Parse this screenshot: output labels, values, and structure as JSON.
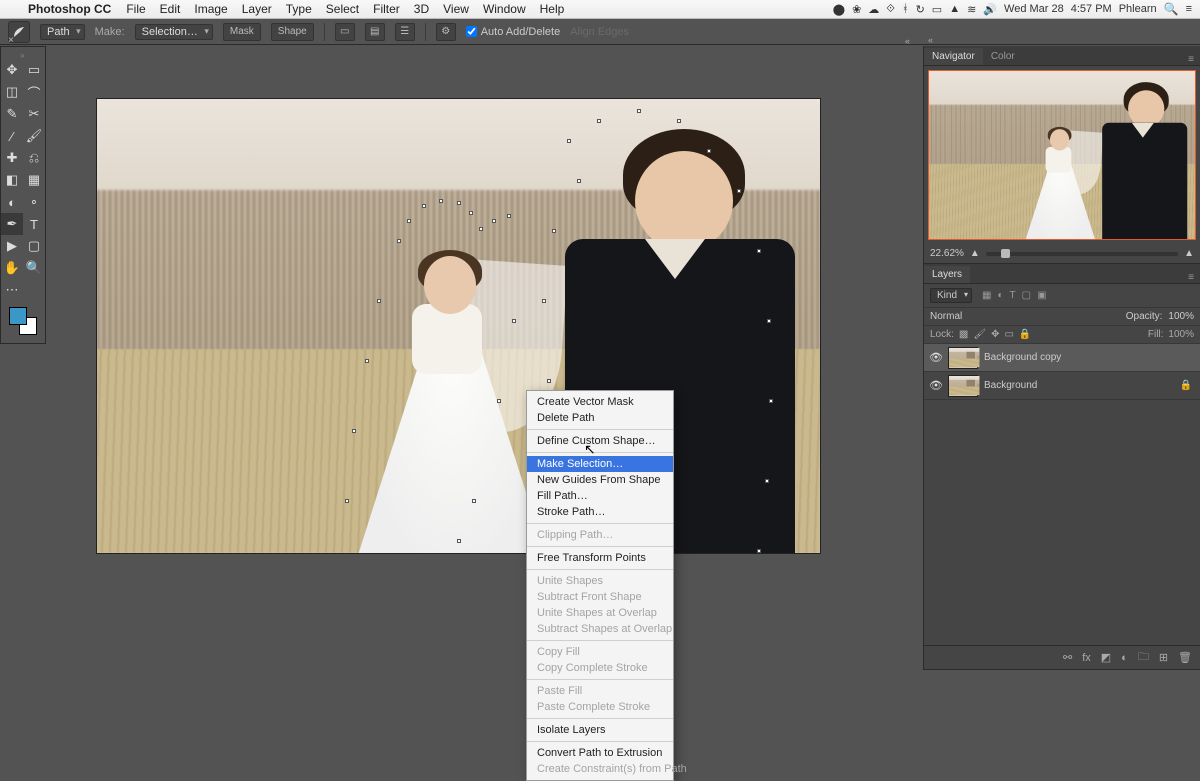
{
  "menubar": {
    "app": "Photoshop CC",
    "items": [
      "File",
      "Edit",
      "Image",
      "Layer",
      "Type",
      "Select",
      "Filter",
      "3D",
      "View",
      "Window",
      "Help"
    ],
    "tray": {
      "date": "Wed Mar 28",
      "time": "4:57 PM",
      "user": "Phlearn"
    }
  },
  "options": {
    "path_label": "Path",
    "make_label": "Make:",
    "make_value": "Selection…",
    "mask_btn": "Mask",
    "shape_btn": "Shape",
    "auto_add": "Auto Add/Delete",
    "align_edges": "Align Edges"
  },
  "navigator": {
    "tab1": "Navigator",
    "tab2": "Color",
    "zoom": "22.62%"
  },
  "layers": {
    "tab": "Layers",
    "kind": "Kind",
    "blend": "Normal",
    "opacity_label": "Opacity:",
    "opacity": "100%",
    "lock_label": "Lock:",
    "fill_label": "Fill:",
    "fill": "100%",
    "items": [
      {
        "name": "Background copy",
        "locked": false
      },
      {
        "name": "Background",
        "locked": true
      }
    ]
  },
  "context_menu": {
    "items": [
      {
        "t": "Create Vector Mask",
        "d": false
      },
      {
        "t": "Delete Path",
        "d": false
      },
      {
        "sep": true
      },
      {
        "t": "Define Custom Shape…",
        "d": false
      },
      {
        "sep": true
      },
      {
        "t": "Make Selection…",
        "d": false,
        "hl": true
      },
      {
        "t": "New Guides From Shape",
        "d": false
      },
      {
        "t": "Fill Path…",
        "d": false
      },
      {
        "t": "Stroke Path…",
        "d": false
      },
      {
        "sep": true
      },
      {
        "t": "Clipping Path…",
        "d": true
      },
      {
        "sep": true
      },
      {
        "t": "Free Transform Points",
        "d": false
      },
      {
        "sep": true
      },
      {
        "t": "Unite Shapes",
        "d": true
      },
      {
        "t": "Subtract Front Shape",
        "d": true
      },
      {
        "t": "Unite Shapes at Overlap",
        "d": true
      },
      {
        "t": "Subtract Shapes at Overlap",
        "d": true
      },
      {
        "sep": true
      },
      {
        "t": "Copy Fill",
        "d": true
      },
      {
        "t": "Copy Complete Stroke",
        "d": true
      },
      {
        "sep": true
      },
      {
        "t": "Paste Fill",
        "d": true
      },
      {
        "t": "Paste Complete Stroke",
        "d": true
      },
      {
        "sep": true
      },
      {
        "t": "Isolate Layers",
        "d": false
      },
      {
        "sep": true
      },
      {
        "t": "Convert Path to Extrusion",
        "d": false
      },
      {
        "t": "Create Constraint(s) from Path",
        "d": true
      }
    ]
  },
  "toolbar_tools": [
    [
      "move",
      "artboard"
    ],
    [
      "marquee",
      "lasso"
    ],
    [
      "quick-select",
      "crop"
    ],
    [
      "eyedropper",
      "brush"
    ],
    [
      "healing",
      "clone"
    ],
    [
      "eraser",
      "gradient"
    ],
    [
      "dodge",
      "blur"
    ],
    [
      "pen",
      "type"
    ],
    [
      "path-select",
      "shape"
    ],
    [
      "hand",
      "zoom"
    ]
  ]
}
